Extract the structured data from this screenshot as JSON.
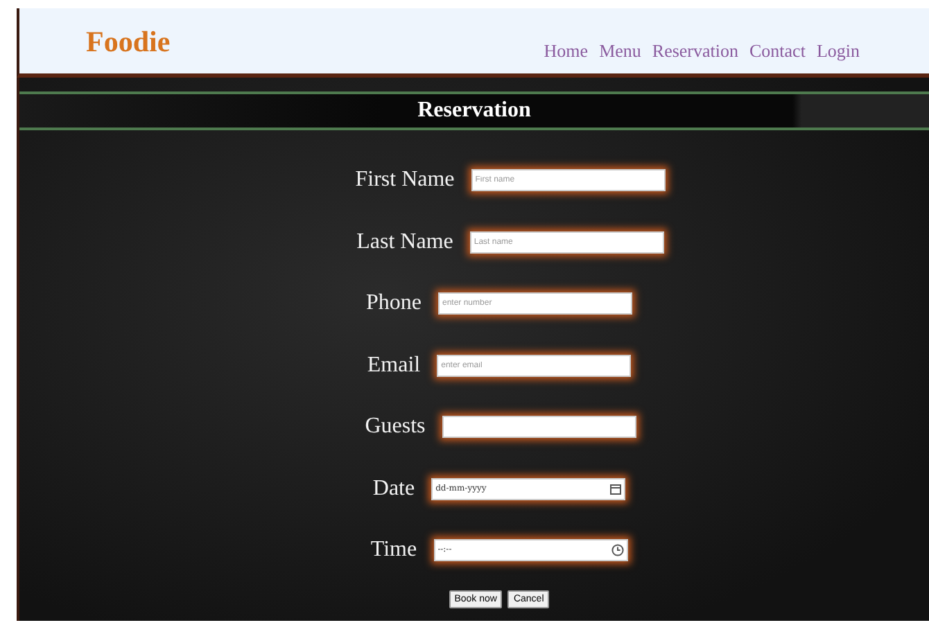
{
  "header": {
    "logo": "Foodie",
    "nav": [
      {
        "label": "Home"
      },
      {
        "label": "Menu"
      },
      {
        "label": "Reservation"
      },
      {
        "label": "Contact"
      },
      {
        "label": "Login"
      }
    ]
  },
  "title": "Reservation",
  "form": {
    "fields": [
      {
        "label": "First Name",
        "kind": "text",
        "placeholder": "First name"
      },
      {
        "label": "Last Name",
        "kind": "text",
        "placeholder": "Last name"
      },
      {
        "label": "Phone",
        "kind": "text",
        "placeholder": "enter number"
      },
      {
        "label": "Email",
        "kind": "text",
        "placeholder": "enter email"
      },
      {
        "label": "Guests",
        "kind": "text"
      },
      {
        "label": "Date",
        "kind": "date",
        "placeholder": "dd-mm-yyyy"
      },
      {
        "label": "Time",
        "kind": "time",
        "placeholder": "--:--"
      }
    ],
    "buttons": [
      "Book now",
      "Cancel"
    ]
  }
}
